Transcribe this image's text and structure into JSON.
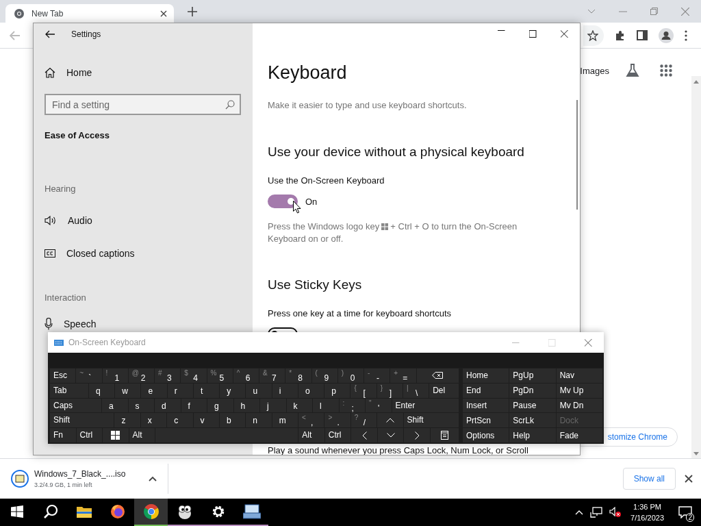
{
  "browser": {
    "tabs": [
      {
        "title": "New Tab",
        "selected": true
      }
    ],
    "images_link": "Images",
    "customize_button": "stomize Chrome"
  },
  "settings": {
    "title": "Settings",
    "home": "Home",
    "search": {
      "placeholder": "Find a setting"
    },
    "category": "Ease of Access",
    "groups": [
      {
        "heading": "Hearing",
        "items": [
          {
            "label": "Audio",
            "kind": "audio"
          },
          {
            "label": "Closed captions",
            "kind": "captions"
          }
        ]
      },
      {
        "heading": "Interaction",
        "items": [
          {
            "label": "Speech",
            "kind": "speech"
          }
        ]
      }
    ],
    "page": {
      "title": "Keyboard",
      "subtitle": "Make it easier to type and use keyboard shortcuts.",
      "sections": [
        {
          "heading": "Use your device without a physical keyboard",
          "setting": "Use the On-Screen Keyboard",
          "toggle": {
            "on": true,
            "label": "On"
          },
          "hint_before": "Press the Windows logo key",
          "hint_after": "+ Ctrl + O to turn the On-Screen",
          "hint_line2": "Keyboard on or off."
        },
        {
          "heading": "Use Sticky Keys",
          "setting": "Press one key at a time for keyboard shortcuts",
          "toggle": {
            "on": false
          }
        }
      ],
      "footer_text": "Play a sound whenever you press Caps Lock, Num Lock, or Scroll"
    }
  },
  "osk": {
    "title": "On-Screen Keyboard",
    "rows": [
      {
        "keys": [
          {
            "label": "Esc",
            "kind": "esc"
          },
          {
            "shift": "~",
            "label": "`",
            "kind": "char"
          },
          {
            "shift": "!",
            "label": "1",
            "kind": "char"
          },
          {
            "shift": "@",
            "label": "2",
            "kind": "char"
          },
          {
            "shift": "#",
            "label": "3",
            "kind": "char"
          },
          {
            "shift": "$",
            "label": "4",
            "kind": "char"
          },
          {
            "shift": "%",
            "label": "5",
            "kind": "char"
          },
          {
            "shift": "^",
            "label": "6",
            "kind": "char"
          },
          {
            "shift": "&",
            "label": "7",
            "kind": "char"
          },
          {
            "shift": "*",
            "label": "8",
            "kind": "char"
          },
          {
            "shift": "(",
            "label": "9",
            "kind": "char"
          },
          {
            "shift": ")",
            "label": "0",
            "kind": "char"
          },
          {
            "shift": "-",
            "label": "-",
            "kind": "char"
          },
          {
            "shift": "+",
            "label": "=",
            "kind": "char"
          },
          {
            "kind": "backspace"
          }
        ]
      },
      {
        "keys": [
          {
            "label": "Tab",
            "kind": "tab"
          },
          {
            "label": "q",
            "kind": "letter"
          },
          {
            "label": "w",
            "kind": "letter"
          },
          {
            "label": "e",
            "kind": "letter"
          },
          {
            "label": "r",
            "kind": "letter"
          },
          {
            "label": "t",
            "kind": "letter"
          },
          {
            "label": "y",
            "kind": "letter"
          },
          {
            "label": "u",
            "kind": "letter"
          },
          {
            "label": "i",
            "kind": "letter"
          },
          {
            "label": "o",
            "kind": "letter"
          },
          {
            "label": "p",
            "kind": "letter"
          },
          {
            "shift": "{",
            "label": "[",
            "kind": "char"
          },
          {
            "shift": "}",
            "label": "]",
            "kind": "char"
          },
          {
            "shift": "|",
            "label": "\\",
            "kind": "char"
          },
          {
            "label": "Del",
            "kind": "del"
          }
        ]
      },
      {
        "keys": [
          {
            "label": "Caps",
            "kind": "caps"
          },
          {
            "label": "a",
            "kind": "letter"
          },
          {
            "label": "s",
            "kind": "letter"
          },
          {
            "label": "d",
            "kind": "letter"
          },
          {
            "label": "f",
            "kind": "letter"
          },
          {
            "label": "g",
            "kind": "letter"
          },
          {
            "label": "h",
            "kind": "letter"
          },
          {
            "label": "j",
            "kind": "letter"
          },
          {
            "label": "k",
            "kind": "letter"
          },
          {
            "label": "l",
            "kind": "letter"
          },
          {
            "shift": ":",
            "label": ";",
            "kind": "char"
          },
          {
            "shift": "\"",
            "label": "'",
            "kind": "char"
          },
          {
            "label": "Enter",
            "kind": "enter"
          }
        ]
      },
      {
        "keys": [
          {
            "label": "Shift",
            "kind": "lshift"
          },
          {
            "label": "z",
            "kind": "letter"
          },
          {
            "label": "x",
            "kind": "letter"
          },
          {
            "label": "c",
            "kind": "letter"
          },
          {
            "label": "v",
            "kind": "letter"
          },
          {
            "label": "b",
            "kind": "letter"
          },
          {
            "label": "n",
            "kind": "letter"
          },
          {
            "label": "m",
            "kind": "letter"
          },
          {
            "shift": "<",
            "label": ",",
            "kind": "char"
          },
          {
            "shift": ">",
            "label": ".",
            "kind": "char"
          },
          {
            "shift": "?",
            "label": "/",
            "kind": "char"
          },
          {
            "kind": "up"
          },
          {
            "label": "Shift",
            "kind": "rshift"
          }
        ]
      },
      {
        "keys": [
          {
            "label": "Fn",
            "kind": "fn"
          },
          {
            "label": "Ctrl",
            "kind": "ctrl"
          },
          {
            "kind": "windows"
          },
          {
            "label": "Alt",
            "kind": "alt"
          },
          {
            "kind": "space"
          },
          {
            "label": "Alt",
            "kind": "alt"
          },
          {
            "label": "Ctrl",
            "kind": "ctrl"
          },
          {
            "kind": "left"
          },
          {
            "kind": "down"
          },
          {
            "kind": "right"
          },
          {
            "kind": "menu"
          }
        ]
      }
    ],
    "nav_keys": [
      {
        "label": "Home",
        "disabled": false
      },
      {
        "label": "PgUp",
        "disabled": false
      },
      {
        "label": "Nav",
        "disabled": false
      },
      {
        "label": "End",
        "disabled": false
      },
      {
        "label": "PgDn",
        "disabled": false
      },
      {
        "label": "Mv Up",
        "disabled": false
      },
      {
        "label": "Insert",
        "disabled": false
      },
      {
        "label": "Pause",
        "disabled": false
      },
      {
        "label": "Mv Dn",
        "disabled": false
      },
      {
        "label": "PrtScn",
        "disabled": false
      },
      {
        "label": "ScrLk",
        "disabled": false
      },
      {
        "label": "Dock",
        "disabled": true
      },
      {
        "label": "Options",
        "disabled": false
      },
      {
        "label": "Help",
        "disabled": false
      },
      {
        "label": "Fade",
        "disabled": false
      }
    ]
  },
  "download": {
    "file": "Windows_7_Black_....iso",
    "status": "3.2/4.9 GB, 1 min left",
    "show_all": "Show all"
  },
  "taskbar": {
    "apps": [
      {
        "kind": "start",
        "selected": false,
        "running": false
      },
      {
        "kind": "search",
        "selected": false,
        "running": false
      },
      {
        "kind": "explorer",
        "selected": false,
        "running": false
      },
      {
        "kind": "firefox",
        "selected": false,
        "running": false
      },
      {
        "kind": "chrome",
        "selected": true,
        "running": true
      },
      {
        "kind": "app",
        "selected": false,
        "running": true
      },
      {
        "kind": "settings",
        "selected": false,
        "running": true
      },
      {
        "kind": "osk",
        "selected": false,
        "running": true
      }
    ],
    "time": "1:36 PM",
    "date": "7/16/2023",
    "notifications": "2"
  }
}
